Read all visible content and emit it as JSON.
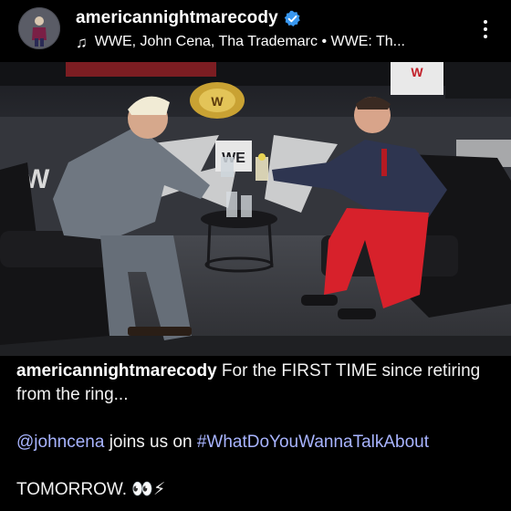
{
  "post": {
    "username": "americannightmarecody",
    "verified": true,
    "music_text": "WWE, John Cena, Tha Trademarc • WWE: Th...",
    "icons": {
      "verified": "verified-badge-icon",
      "music": "music-note-icon",
      "more": "more-options-icon"
    },
    "colors": {
      "background": "#000000",
      "verified_badge": "#3897f0",
      "mention_link": "#a8b4ff",
      "pants": "#d7212b"
    }
  },
  "image": {
    "signage_left": "W",
    "signage_right": "W",
    "backdrop_logo": "WE"
  },
  "caption": {
    "username": "americannightmarecody",
    "line1_text": " For the FIRST TIME since retiring from the ring...",
    "mention": "@johncena",
    "middle_text": " joins us on ",
    "hashtag": "#WhatDoYouWannaTalkAbout",
    "final_text": "TOMORROW.",
    "final_emojis": "👀⚡"
  }
}
